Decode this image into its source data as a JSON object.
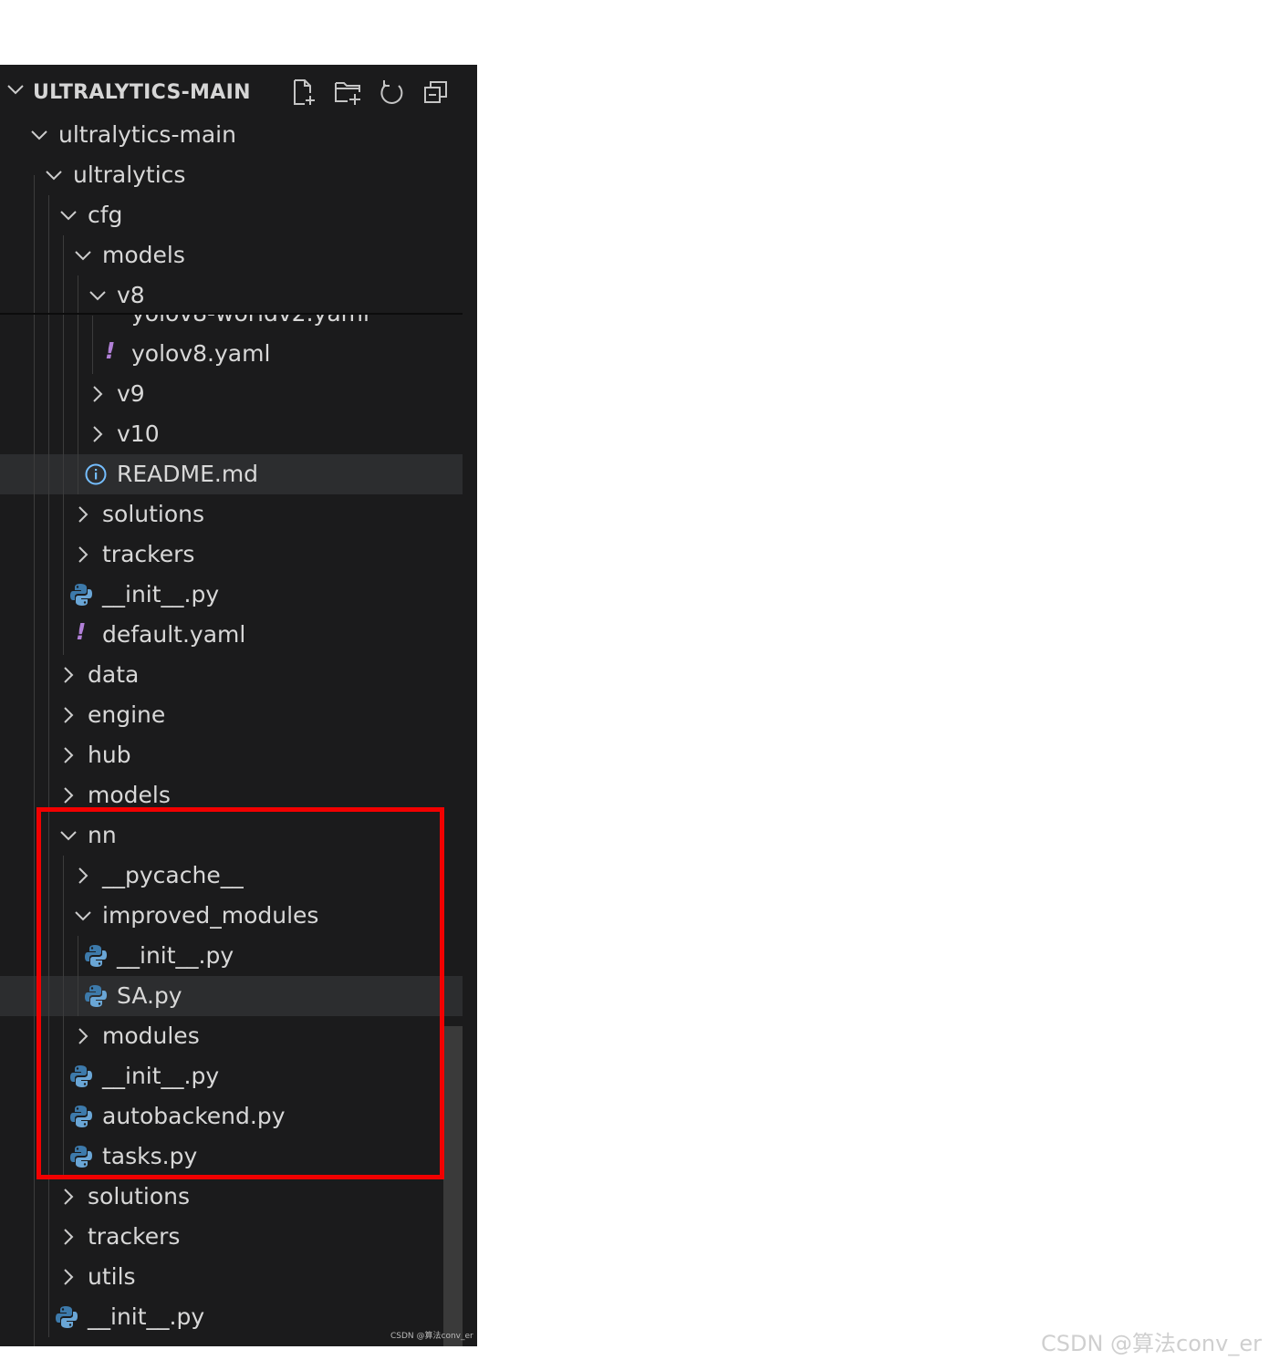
{
  "explorer": {
    "title": "ULTRALYTICS-MAIN",
    "toolbar": [
      {
        "name": "new-file-icon"
      },
      {
        "name": "new-folder-icon"
      },
      {
        "name": "refresh-icon"
      },
      {
        "name": "collapse-all-icon"
      }
    ],
    "partial_item": "yolov8-worldv2.yaml",
    "rows": [
      {
        "label": "ultralytics-main",
        "kind": "folder",
        "open": true,
        "depth": 1
      },
      {
        "label": "ultralytics",
        "kind": "folder",
        "open": true,
        "depth": 2
      },
      {
        "label": "cfg",
        "kind": "folder",
        "open": true,
        "depth": 3
      },
      {
        "label": "models",
        "kind": "folder",
        "open": true,
        "depth": 4
      },
      {
        "label": "v8",
        "kind": "folder",
        "open": true,
        "depth": 5
      },
      {
        "label": "yolov8.yaml",
        "kind": "yaml",
        "depth": 6
      },
      {
        "label": "v9",
        "kind": "folder",
        "open": false,
        "depth": 5
      },
      {
        "label": "v10",
        "kind": "folder",
        "open": false,
        "depth": 5
      },
      {
        "label": "README.md",
        "kind": "info",
        "depth": 5,
        "selected": true
      },
      {
        "label": "solutions",
        "kind": "folder",
        "open": false,
        "depth": 4
      },
      {
        "label": "trackers",
        "kind": "folder",
        "open": false,
        "depth": 4
      },
      {
        "label": "__init__.py",
        "kind": "python",
        "depth": 4
      },
      {
        "label": "default.yaml",
        "kind": "yaml",
        "depth": 4
      },
      {
        "label": "data",
        "kind": "folder",
        "open": false,
        "depth": 3
      },
      {
        "label": "engine",
        "kind": "folder",
        "open": false,
        "depth": 3
      },
      {
        "label": "hub",
        "kind": "folder",
        "open": false,
        "depth": 3
      },
      {
        "label": "models",
        "kind": "folder",
        "open": false,
        "depth": 3
      },
      {
        "label": "nn",
        "kind": "folder",
        "open": true,
        "depth": 3
      },
      {
        "label": "__pycache__",
        "kind": "folder",
        "open": false,
        "depth": 4
      },
      {
        "label": "improved_modules",
        "kind": "folder",
        "open": true,
        "depth": 4
      },
      {
        "label": "__init__.py",
        "kind": "python",
        "depth": 5
      },
      {
        "label": "SA.py",
        "kind": "python",
        "depth": 5,
        "selected": true
      },
      {
        "label": "modules",
        "kind": "folder",
        "open": false,
        "depth": 4
      },
      {
        "label": "__init__.py",
        "kind": "python",
        "depth": 4
      },
      {
        "label": "autobackend.py",
        "kind": "python",
        "depth": 4
      },
      {
        "label": "tasks.py",
        "kind": "python",
        "depth": 4
      },
      {
        "label": "solutions",
        "kind": "folder",
        "open": false,
        "depth": 3
      },
      {
        "label": "trackers",
        "kind": "folder",
        "open": false,
        "depth": 3
      },
      {
        "label": "utils",
        "kind": "folder",
        "open": false,
        "depth": 3
      },
      {
        "label": "__init__.py",
        "kind": "python",
        "depth": 3
      }
    ]
  },
  "colors": {
    "panel_bg": "#1b1b1c",
    "selected_bg": "#2c2d2f",
    "text": "#d8d8d8",
    "yaml_icon": "#b180d7",
    "info_icon": "#75beff",
    "python_blue": "#3d7aab",
    "python_light": "#6aa6d6",
    "highlight_box": "#f20000"
  },
  "yaml_glyph": "!",
  "watermark": {
    "small": "CSDN @算法conv_er",
    "big": "CSDN @算法conv_er"
  }
}
